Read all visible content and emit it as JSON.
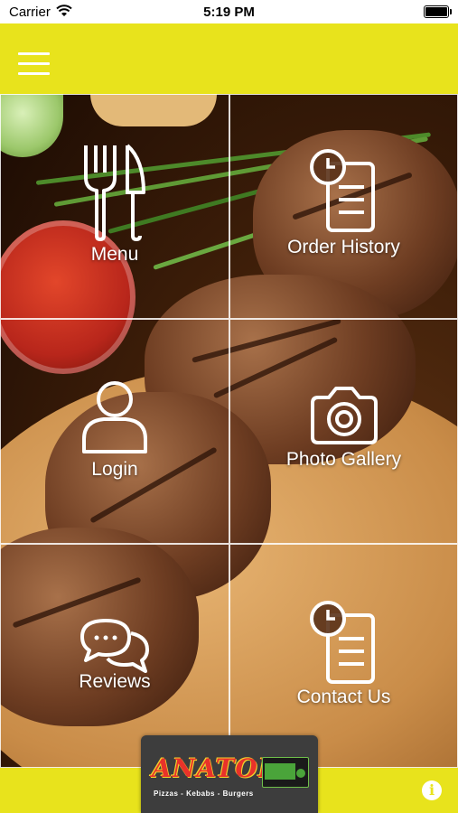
{
  "status_bar": {
    "carrier": "Carrier",
    "time": "5:19 PM"
  },
  "header": {
    "menu_icon": "hamburger-icon"
  },
  "tiles": [
    {
      "label": "Menu",
      "icon": "cutlery-icon"
    },
    {
      "label": "Order History",
      "icon": "clock-document-icon"
    },
    {
      "label": "Login",
      "icon": "user-icon"
    },
    {
      "label": "Photo Gallery",
      "icon": "camera-icon"
    },
    {
      "label": "Reviews",
      "icon": "chat-bubbles-icon"
    },
    {
      "label": "Contact Us",
      "icon": "clock-document-icon"
    }
  ],
  "logo": {
    "brand": "ANATOLIA",
    "tagline": "Pizzas - Kebabs - Burgers"
  },
  "footer": {
    "info_icon": "info-icon"
  },
  "colors": {
    "accent": "#e8e31c"
  }
}
